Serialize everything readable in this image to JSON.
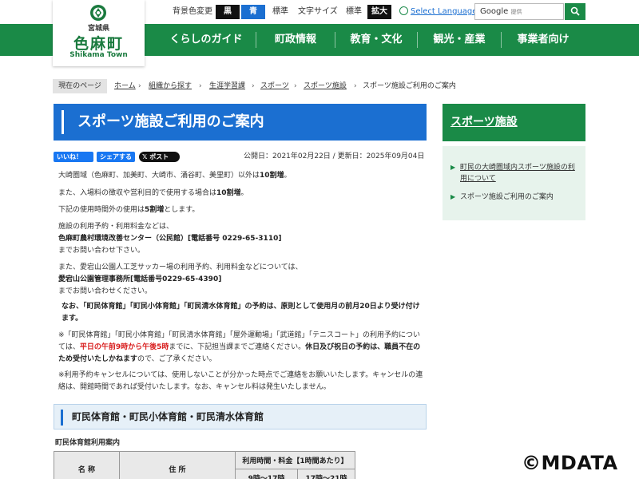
{
  "utility": {
    "bg_color_label": "背景色変更",
    "bg_black": "黒",
    "bg_blue": "青",
    "bg_standard": "標準",
    "text_size_label": "文字サイズ",
    "size_standard": "標準",
    "size_large": "拡大",
    "language_label": "Select Language",
    "search_brand": "Google",
    "search_suffix": "提供"
  },
  "logo": {
    "prefecture": "宮城県",
    "town": "色麻町",
    "roman": "Shikama Town"
  },
  "nav": [
    {
      "label": "くらしのガイド"
    },
    {
      "label": "町政情報"
    },
    {
      "label": "教育・文化"
    },
    {
      "label": "観光・産業"
    },
    {
      "label": "事業者向け"
    }
  ],
  "breadcrumb": {
    "current_label": "現在のページ",
    "items": [
      "ホーム",
      "組織から探す",
      "生涯学習課",
      "スポーツ",
      "スポーツ施設"
    ],
    "last": "スポーツ施設ご利用のご案内",
    "separator": "›"
  },
  "page": {
    "title": "スポーツ施設ご利用のご案内",
    "share_like": "いいね！",
    "share_share": "シェアする",
    "share_post": "ポスト",
    "published": "公開日：2021年02月22日",
    "updated": "更新日：2025年09月04日"
  },
  "body": {
    "p1_a": "大崎圏域（色麻町、加美町、大崎市、涌谷町、美里町）以外は",
    "p1_b": "10割増",
    "p1_c": "。",
    "p2_a": "また、入場料の徴収や営利目的で使用する場合は",
    "p2_b": "10割増",
    "p2_c": "。",
    "p3_a": "下記の使用時間外の使用は",
    "p3_b": "5割増",
    "p3_c": "とします。",
    "p4_l1": "施設の利用予約・利用料金などは、",
    "p4_l2": "色麻町農村環境改善センター（公民館）[電話番号 0229-65-3110]",
    "p4_l3": "までお問い合わせ下さい。",
    "p5_l1": "また、愛宕山公園人工芝サッカー場の利用予約、利用料金などについては、",
    "p5_l2": "愛宕山公園管理事務所[電話番号0229-65-4390]",
    "p5_l3": "までお問い合わせください。",
    "p6": "なお、「町民体育館」「町民小体育館」「町民清水体育館」の予約は、原則として使用月の前月20日より受け付けます。",
    "p7_a": "※「町民体育館」「町民小体育館」「町民清水体育館」「屋外運動場」「武道館」「テニスコート」の利用予約については、",
    "p7_red": "平日の午前9時から午後5時",
    "p7_b": "までに、下記担当課までご連絡ください。",
    "p7_bold": "休日及び祝日の予約は、職員不在のため受付いたしかねます",
    "p7_c": "ので、ご了承ください。",
    "p8": "※利用予約キャンセルについては、使用しないことが分かった時点でご連絡をお願いいたします。キャンセルの連絡は、開館時間であれば受付いたします。なお、キャンセル料は発生いたしません。"
  },
  "section": {
    "heading": "町民体育館・町民小体育館・町民清水体育館",
    "caption": "町民体育館利用案内",
    "table": {
      "col_name": "名 称",
      "col_address": "住 所",
      "col_usage": "利用時間・料金【1時間あたり】",
      "col_t1": "9時～17時",
      "col_t2": "17時～21時"
    }
  },
  "sidebar": {
    "heading": "スポーツ施設",
    "items": [
      {
        "label": "町民の大崎圏域内スポーツ施設の利用について"
      },
      {
        "label": "スポーツ施設ご利用のご案内"
      }
    ]
  },
  "watermark": "©MDATA",
  "colors": {
    "brand_green": "#1a8a47",
    "title_blue": "#1b6fd1",
    "alert_red": "#d81b1b"
  }
}
